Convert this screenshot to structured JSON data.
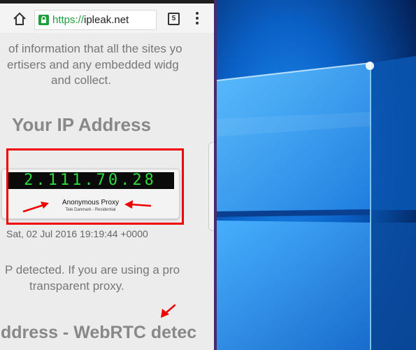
{
  "browser": {
    "url_scheme": "https://",
    "url_host": "ipleak.net",
    "tab_count": "5"
  },
  "page": {
    "intro_line1": "of information that all the sites yo",
    "intro_line2": "ertisers and any embedded widg",
    "intro_line3": "and collect.",
    "ip_heading": "Your IP Address",
    "ip_value": "2.111.70.28",
    "proxy_label": "Anonymous Proxy",
    "proxy_isp": "Tele Danmark - Residential",
    "timestamp": "Sat, 02 Jul 2016 19:19:44 +0000",
    "proxy_note_line1": "P detected. If you are using a pro",
    "proxy_note_line2": "transparent proxy.",
    "webrtc_heading": "ddress - WebRTC detec"
  },
  "colors": {
    "annotation_red": "#ee0000",
    "ip_led_green": "#2ddc3a",
    "secure_green": "#1e9e3c",
    "desktop_blue": "#0a6ad6"
  }
}
